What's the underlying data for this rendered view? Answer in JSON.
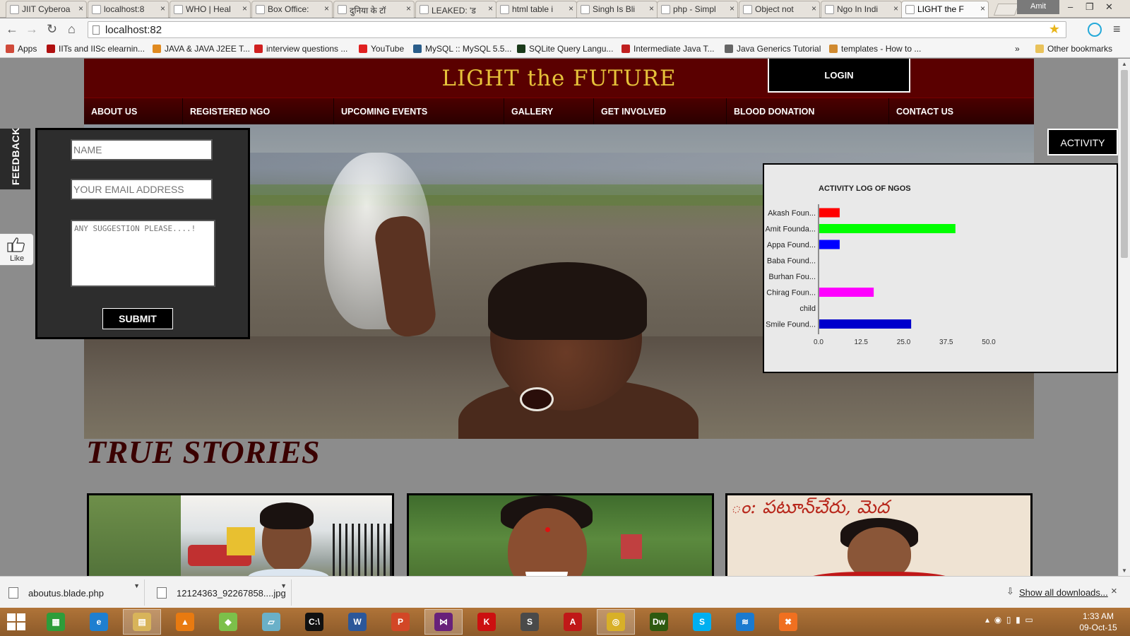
{
  "browser": {
    "tabs": [
      {
        "label": "JIIT Cyberoa",
        "active": false
      },
      {
        "label": "localhost:8",
        "active": false
      },
      {
        "label": "WHO | Heal",
        "active": false
      },
      {
        "label": "Box Office:",
        "active": false
      },
      {
        "label": "दुनिया के टॉ",
        "active": false
      },
      {
        "label": "LEAKED: 'ड",
        "active": false
      },
      {
        "label": "html table i",
        "active": false
      },
      {
        "label": "Singh Is Bli",
        "active": false
      },
      {
        "label": "php - Simpl",
        "active": false
      },
      {
        "label": "Object not",
        "active": false
      },
      {
        "label": "Ngo In Indi",
        "active": false
      },
      {
        "label": "LIGHT the F",
        "active": true
      }
    ],
    "profile": "Amit",
    "url": "localhost:82",
    "bookmarks": [
      {
        "label": "Apps",
        "color": "#d04a3a"
      },
      {
        "label": "IITs and IISc elearnin...",
        "color": "#b01010"
      },
      {
        "label": "JAVA & JAVA J2EE T...",
        "color": "#e08a20"
      },
      {
        "label": "interview questions ...",
        "color": "#d02020"
      },
      {
        "label": "YouTube",
        "color": "#e02020"
      },
      {
        "label": "MySQL :: MySQL 5.5...",
        "color": "#2a5d8a"
      },
      {
        "label": "SQLite Query Langu...",
        "color": "#1a3a1a"
      },
      {
        "label": "Intermediate Java T...",
        "color": "#c02020"
      },
      {
        "label": "Java Generics Tutorial",
        "color": "#666666"
      },
      {
        "label": "templates - How to ...",
        "color": "#d08a30"
      }
    ],
    "other_bookmarks": "Other bookmarks",
    "overflow": "»"
  },
  "site": {
    "title": "LIGHT the FUTURE",
    "login": "LOGIN",
    "nav": [
      "ABOUT US",
      "REGISTERED NGO",
      "UPCOMING EVENTS",
      "GALLERY",
      "GET INVOLVED",
      "BLOOD DONATION",
      "CONTACT US"
    ],
    "feedback": {
      "tab_label": "FEEDBACK",
      "name_placeholder": "NAME",
      "email_placeholder": "YOUR EMAIL ADDRESS",
      "suggestion_placeholder": "ANY SUGGESTION PLEASE....!",
      "submit": "SUBMIT",
      "like": "Like"
    },
    "activity_button": "ACTIVITY",
    "stories_heading": "TRUE STORIES",
    "story3_text": "ం: పటూన్‌చేరు, మెద"
  },
  "chart_data": {
    "type": "bar",
    "orientation": "horizontal",
    "title": "ACTIVITY LOG OF NGOS",
    "categories": [
      "Akash Foun...",
      "Amit Founda...",
      "Appa Found...",
      "Baba Found...",
      "Burhan Fou...",
      "Chirag Foun...",
      "child",
      "Smile Found..."
    ],
    "values": [
      6,
      40,
      6,
      0,
      0,
      16,
      0,
      27
    ],
    "colors": [
      "#ff0000",
      "#00ff00",
      "#0000ff",
      "#ffff00",
      "#00ffff",
      "#ff00ff",
      "#808080",
      "#0000cc"
    ],
    "xticks": [
      "0.0",
      "12.5",
      "25.0",
      "37.5",
      "50.0"
    ],
    "xlim": [
      0,
      50
    ]
  },
  "downloads": {
    "items": [
      "aboutus.blade.php",
      "12124363_92267858....jpg"
    ],
    "show_all": "Show all downloads...",
    "close": "×"
  },
  "taskbar": {
    "apps": [
      {
        "name": "store",
        "color": "#2d9d3a",
        "glyph": "▦"
      },
      {
        "name": "internet-explorer",
        "color": "#1e7fd0",
        "glyph": "e"
      },
      {
        "name": "file-explorer",
        "color": "#d8b45a",
        "glyph": "▤"
      },
      {
        "name": "vlc",
        "color": "#e87a10",
        "glyph": "▲"
      },
      {
        "name": "photos",
        "color": "#7cc04a",
        "glyph": "◆"
      },
      {
        "name": "notes",
        "color": "#6ab0c8",
        "glyph": "▱"
      },
      {
        "name": "command-prompt",
        "color": "#111111",
        "glyph": "C:\\"
      },
      {
        "name": "word",
        "color": "#2b579a",
        "glyph": "W"
      },
      {
        "name": "powerpoint",
        "color": "#d24726",
        "glyph": "P"
      },
      {
        "name": "visual-studio",
        "color": "#68217a",
        "glyph": "⋈"
      },
      {
        "name": "kaspersky",
        "color": "#cc1010",
        "glyph": "K"
      },
      {
        "name": "sublime-text",
        "color": "#4a4a4a",
        "glyph": "S"
      },
      {
        "name": "acrobat",
        "color": "#c01818",
        "glyph": "A"
      },
      {
        "name": "chrome",
        "color": "#d8b028",
        "glyph": "◎"
      },
      {
        "name": "dreamweaver",
        "color": "#2e5a10",
        "glyph": "Dw"
      },
      {
        "name": "skype",
        "color": "#00aff0",
        "glyph": "S"
      },
      {
        "name": "wifi",
        "color": "#1a7ad0",
        "glyph": "≋"
      },
      {
        "name": "xampp",
        "color": "#f07020",
        "glyph": "✖"
      }
    ],
    "time": "1:33 AM",
    "date": "09-Oct-15"
  }
}
